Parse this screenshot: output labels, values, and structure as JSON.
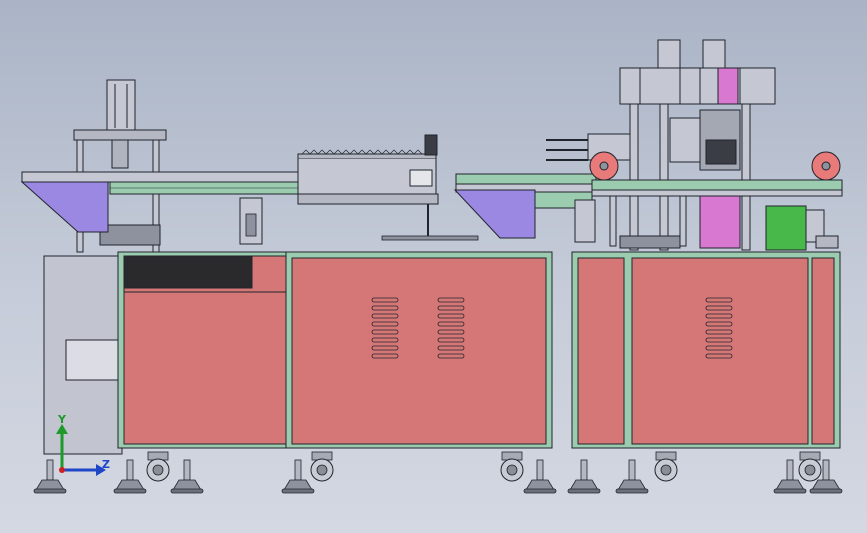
{
  "viewport": {
    "background": "#bcc4d2"
  },
  "axes": {
    "y_label": "Y",
    "z_label": "Z",
    "y_color": "#1e9a2a",
    "z_color": "#2046c8",
    "x_color": "#d21e1e"
  },
  "colors": {
    "cabinet": "#d67777",
    "frame_rail": "#9cccb0",
    "hopper": "#9a88e2",
    "steel": "#c5c8d2",
    "dark_panel": "#2a2a2c",
    "magenta_part": "#d878d0",
    "green_roller": "#49b84a",
    "outline": "#20242c"
  }
}
